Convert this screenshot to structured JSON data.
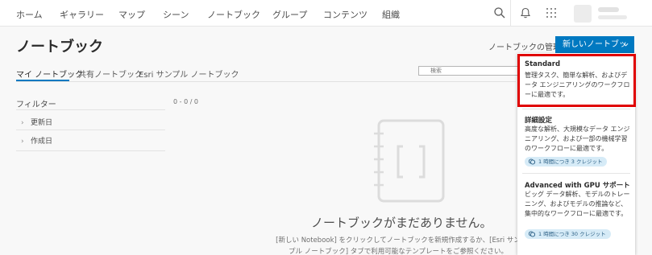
{
  "nav": {
    "items": [
      "ホーム",
      "ギャラリー",
      "マップ",
      "シーン",
      "ノートブック",
      "グループ",
      "コンテンツ",
      "組織"
    ]
  },
  "page": {
    "title": "ノートブック",
    "manage_label": "ノートブックの管理",
    "new_button_label": "新しいノートブック"
  },
  "tabs": [
    "マイ ノートブック",
    "共有ノートブック",
    "Esri サンプル ノートブック"
  ],
  "search": {
    "placeholder": "検索"
  },
  "filter": {
    "title": "フィルター",
    "items": [
      "更新日",
      "作成日"
    ],
    "count": "0 - 0 / 0"
  },
  "empty": {
    "title": "ノートブックがまだありません。",
    "desc_line1": "[新しい Notebook] をクリックしてノートブックを新規作成するか、[Esri サン",
    "desc_line2": "プル ノートブック] タブで利用可能なテンプレートをご参照ください。"
  },
  "dropdown": {
    "options": [
      {
        "title": "Standard",
        "desc": "管理タスク、簡単な解析、およびデータ エンジニアリングのワークフローに最適です。"
      },
      {
        "title": "詳細設定",
        "desc": "高度な解析、大規模なデータ エンジニアリング、および一部の機械学習のワークフローに最適です。",
        "credit": "1 時間につき 3 クレジット"
      },
      {
        "title": "Advanced with GPU サポート",
        "desc": "ビッグ データ解析、モデルのトレーニング、およびモデルの推論など、集中的なワークフローに最適です。",
        "credit": "1 時間につき 30 クレジット"
      }
    ]
  },
  "colors": {
    "primary": "#0079c1",
    "highlight": "#e00000",
    "credit_bg": "#d6ebf7"
  },
  "icons": {
    "search": "search-icon",
    "bell": "bell-icon",
    "apps": "apps-grid-icon",
    "chevron": "chevron-down-icon",
    "coin": "credit-coin-icon"
  }
}
